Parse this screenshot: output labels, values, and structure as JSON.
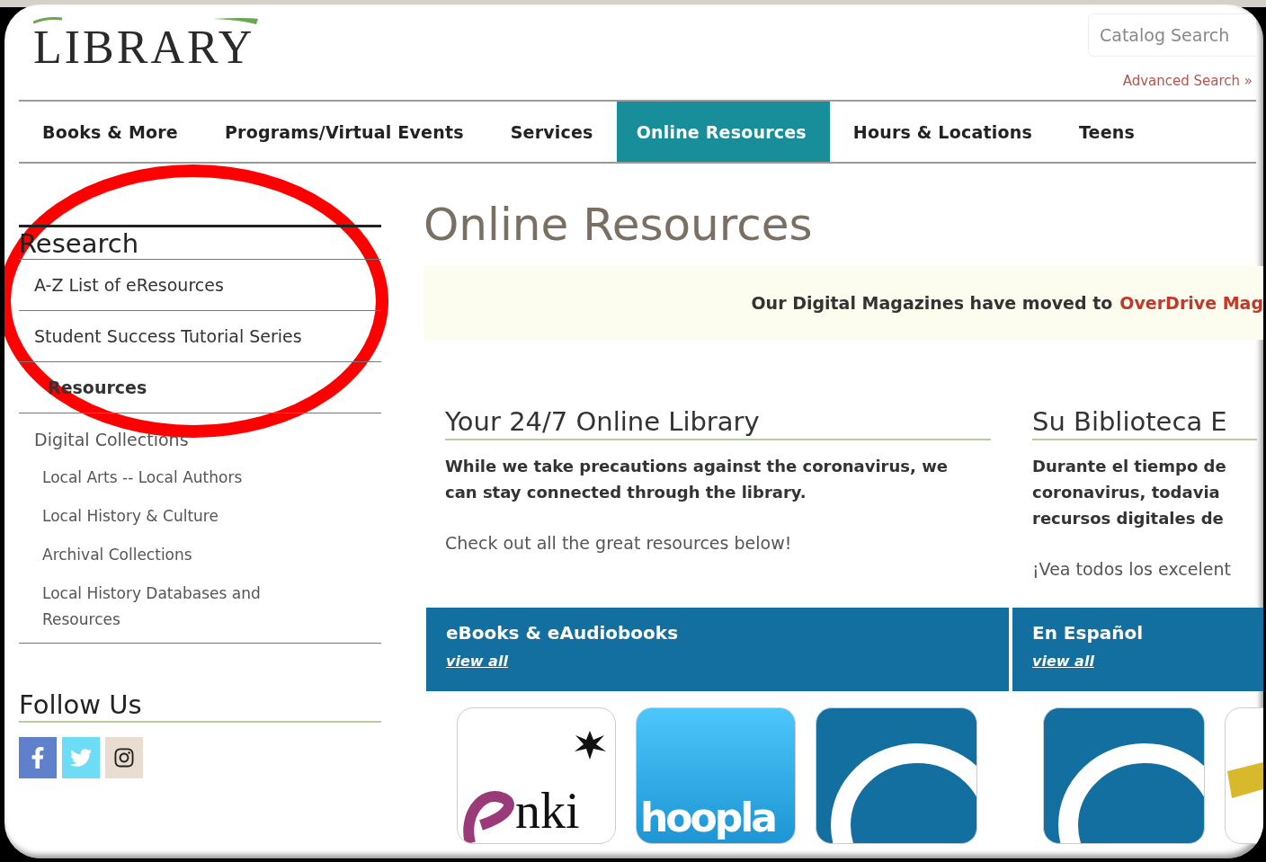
{
  "logo": {
    "text": "LIBRARY"
  },
  "search": {
    "placeholder": "Catalog Search",
    "advanced_link": "Advanced Search »"
  },
  "nav": [
    {
      "label": "Books & More",
      "selected": false
    },
    {
      "label": "Programs/Virtual Events",
      "selected": false
    },
    {
      "label": "Services",
      "selected": false
    },
    {
      "label": "Online Resources",
      "selected": true
    },
    {
      "label": "Hours & Locations",
      "selected": false
    },
    {
      "label": "Teens",
      "selected": false
    }
  ],
  "sidebar": {
    "research_title": "Research",
    "research_items": [
      {
        "label": "A-Z List of eResources",
        "selected": false
      },
      {
        "label": "Student Success Tutorial Series",
        "selected": false
      },
      {
        "label": "Resources",
        "selected": true
      }
    ],
    "collections": {
      "label": "Digital Collections",
      "children": [
        {
          "label": "Local Arts -- Local Authors"
        },
        {
          "label": "Local History & Culture"
        },
        {
          "label": "Archival Collections"
        },
        {
          "label": "Local History Databases and Resources"
        }
      ]
    },
    "follow_title": "Follow Us",
    "social": [
      {
        "kind": "facebook"
      },
      {
        "kind": "twitter"
      },
      {
        "kind": "instagram"
      }
    ]
  },
  "main": {
    "title": "Online Resources",
    "banner": {
      "text": "Our Digital Magazines have moved to",
      "link": "OverDrive Mag"
    },
    "columns": [
      {
        "heading": "Your 24/7 Online Library",
        "lead": "While we take precautions against the coronavirus, we can stay connected through the library.",
        "note": "Check out all the great resources below!"
      },
      {
        "heading": "Su Biblioteca E",
        "lead_lines": [
          "Durante el tiempo de",
          "coronavirus, todavia",
          "recursos digitales de"
        ],
        "note": "¡Vea todos los excelent"
      }
    ],
    "sections": [
      {
        "title": "eBooks & eAudiobooks",
        "link": "view all",
        "tiles": [
          {
            "kind": "enki",
            "text": "nki"
          },
          {
            "kind": "hoopla",
            "text": "hoopla"
          },
          {
            "kind": "ring"
          }
        ]
      },
      {
        "title": "En Español",
        "link": "view all",
        "tiles": [
          {
            "kind": "ring"
          },
          {
            "kind": "partial"
          }
        ]
      }
    ]
  },
  "annotation": {
    "kind": "ellipse",
    "color": "#ff0000"
  }
}
